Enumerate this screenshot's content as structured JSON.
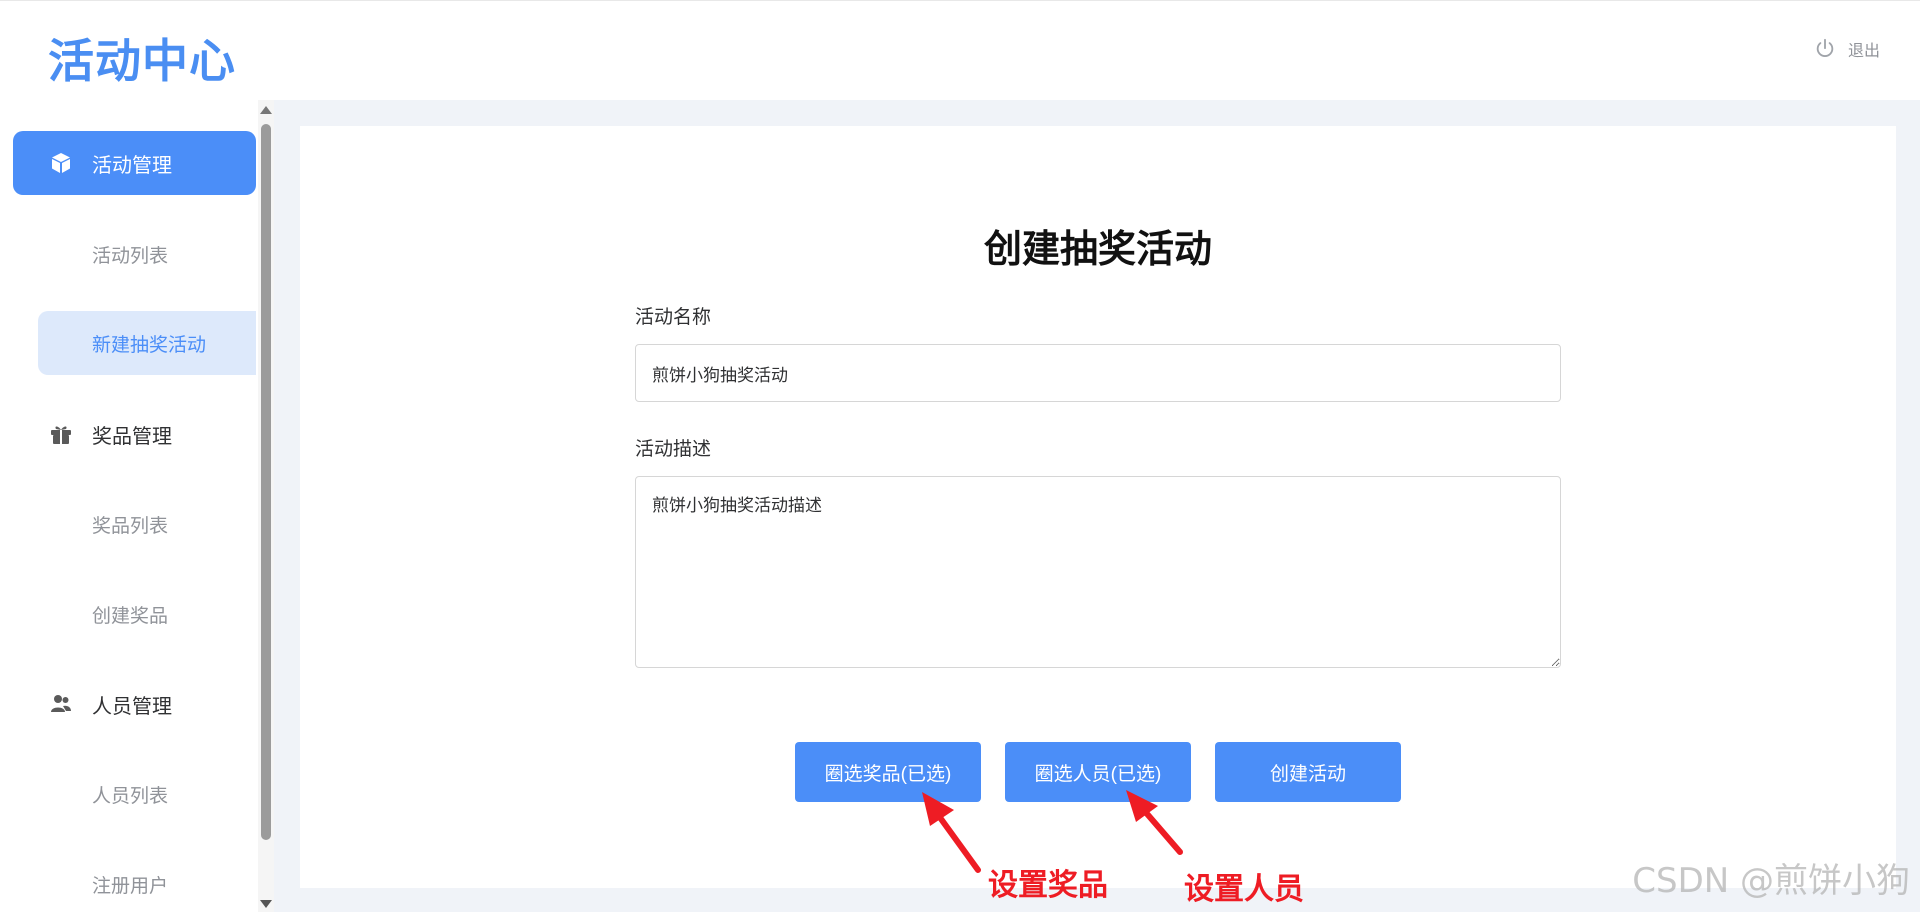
{
  "header": {
    "logo": "活动中心",
    "logout_label": "退出"
  },
  "sidebar": {
    "groups": [
      {
        "label": "活动管理",
        "icon": "cube-icon",
        "active": true,
        "items": [
          {
            "label": "活动列表",
            "selected": false
          },
          {
            "label": "新建抽奖活动",
            "selected": true
          }
        ]
      },
      {
        "label": "奖品管理",
        "icon": "gift-icon",
        "active": false,
        "items": [
          {
            "label": "奖品列表",
            "selected": false
          },
          {
            "label": "创建奖品",
            "selected": false
          }
        ]
      },
      {
        "label": "人员管理",
        "icon": "users-icon",
        "active": false,
        "items": [
          {
            "label": "人员列表",
            "selected": false
          },
          {
            "label": "注册用户",
            "selected": false
          }
        ]
      }
    ]
  },
  "form": {
    "title": "创建抽奖活动",
    "name_label": "活动名称",
    "name_value": "煎饼小狗抽奖活动",
    "desc_label": "活动描述",
    "desc_value": "煎饼小狗抽奖活动描述",
    "buttons": {
      "select_prizes": "圈选奖品(已选)",
      "select_people": "圈选人员(已选)",
      "create": "创建活动"
    }
  },
  "annotations": {
    "set_prizes": "设置奖品",
    "set_people": "设置人员"
  },
  "watermark": "CSDN @煎饼小狗",
  "colors": {
    "primary": "#4b8ef8",
    "selected_bg": "#dde9fb",
    "annotation_red": "#ee1c24",
    "main_bg": "#f0f3f8"
  }
}
